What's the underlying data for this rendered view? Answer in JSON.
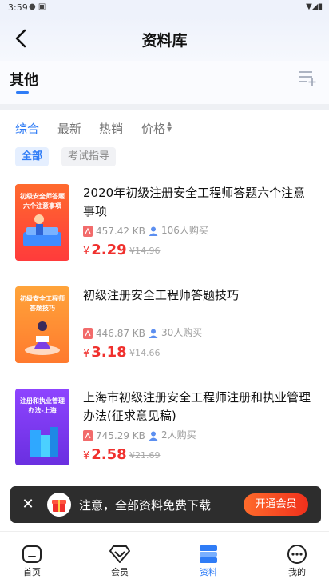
{
  "status_bar": {
    "time": "3:59"
  },
  "header": {
    "title": "资料库"
  },
  "category": {
    "title": "其他"
  },
  "sort": {
    "items": [
      "综合",
      "最新",
      "热销",
      "价格"
    ],
    "active": "综合"
  },
  "filters": [
    "全部",
    "考试指导"
  ],
  "items": [
    {
      "title": "2020年初级注册安全工程师答题六个注意事项",
      "thumb_text": "初级安全师答题六个注意事项",
      "size": "457.42 KB",
      "buyers": "106人购买",
      "price_symbol": "¥",
      "price": "2.29",
      "original_price": "¥14.96",
      "thumb_colors": [
        "#ff6a2e",
        "#ff3b3b"
      ]
    },
    {
      "title": "初级注册安全工程师答题技巧",
      "thumb_text": "初级安全工程师答题技巧",
      "size": "446.87 KB",
      "buyers": "30人购买",
      "price_symbol": "¥",
      "price": "3.18",
      "original_price": "¥14.66",
      "thumb_colors": [
        "#ffa43a",
        "#ff7a2e"
      ]
    },
    {
      "title": "上海市初级注册安全工程师注册和执业管理办法(征求意见稿)",
      "thumb_text": "注册和执业管理办法-上海",
      "size": "745.29 KB",
      "buyers": "2人购买",
      "price_symbol": "¥",
      "price": "2.58",
      "original_price": "¥21.69",
      "thumb_colors": [
        "#8e44ff",
        "#6a2fe0"
      ]
    }
  ],
  "promo": {
    "text": "注意，全部资料免费下载",
    "button": "开通会员"
  },
  "tabbar": {
    "items": [
      "首页",
      "会员",
      "资料",
      "我的"
    ],
    "active": "资料"
  },
  "colors": {
    "accent": "#2f7cf6",
    "price": "#f0302d",
    "promo_bg": "#2d2d2d"
  }
}
